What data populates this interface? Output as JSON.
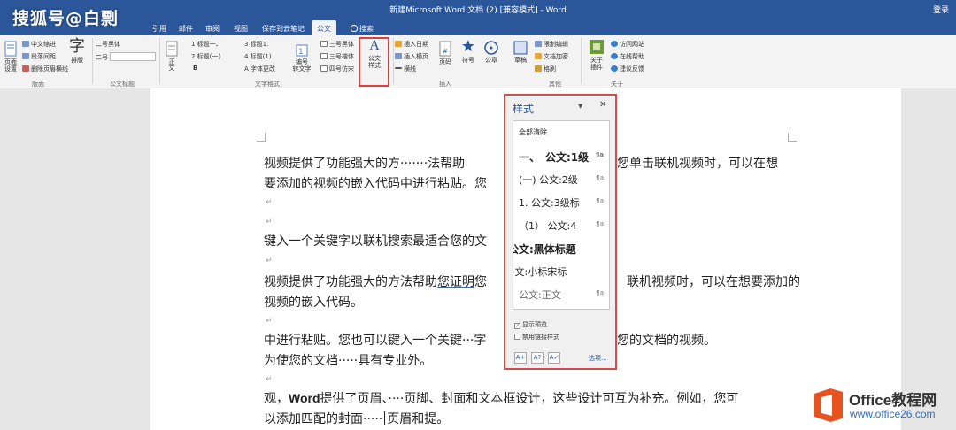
{
  "watermark": "搜狐号@白剽",
  "window": {
    "title": "新建Microsoft Word 文档 (2) [兼容模式] - Word",
    "signin": "登录"
  },
  "tabs": [
    {
      "label": "引用"
    },
    {
      "label": "邮件"
    },
    {
      "label": "审阅"
    },
    {
      "label": "视图"
    },
    {
      "label": "保存到云笔记"
    },
    {
      "label": "公文"
    },
    {
      "label": "搜索"
    }
  ],
  "ribbon": {
    "page_setup": "页面\n设置",
    "cn_indent": "中文缩进",
    "spacing": "段落间距",
    "delete_line": "删除页眉横线",
    "typeset": "排版",
    "group_layout": "版面",
    "font_name": "二号黑体",
    "font_size": "二号",
    "group_doc_title": "公文标题",
    "zhengwen": "正文",
    "h1": "1 标题一、",
    "h2": "2 标题(一)",
    "bold": "B",
    "h3": "3 标题1.",
    "h4": "4 标题(1)",
    "font_change": "A 字体更改",
    "number_to_text": "编号\n转文字",
    "three_bold": "三号黑体",
    "three_kai": "三号楷体",
    "four_fangsong": "四号仿宋",
    "group_text_format": "文字格式",
    "doc_style": "公文\n样式",
    "insert_date": "插入日期",
    "insert_header": "插入横页",
    "line": "横线",
    "group_insert": "插入",
    "page_num": "页码",
    "symbol": "符号",
    "seal": "公章",
    "draft": "草稿",
    "restrict_edit": "限制编辑",
    "doc_encrypt": "文档加密",
    "format_painter": "格刷",
    "group_other": "其他",
    "about_plugin": "关于\n插件",
    "visit_site": "访问网站",
    "online_help": "在线帮助",
    "feedback": "建议反馈",
    "group_about": "关于"
  },
  "document": {
    "lines": [
      "视频提供了功能强大的方·······法帮助",
      "您单击联机视频时，可以在想",
      "要添加的视频的嵌入代码中进行粘贴。您",
      "键入一个关键字以联机搜索最适合您的文",
      "视频提供了功能强大的方法帮助",
      "您证明",
      "您",
      "联机视频时，可以在想要添加的",
      "视频的嵌入代码。",
      "中进行粘贴。您也可以键入一个关键···字",
      "您的文档的视频。",
      "为使您的文档·····具有专业外。",
      "观，",
      "Word",
      "提供了页眉、····页脚、封面和文本框设计，这些设计可互为补充。例如，您可",
      "以添加匹配的封面·····",
      "页眉和提。"
    ]
  },
  "styles_pane": {
    "title": "样式",
    "clear_all": "全部清除",
    "items": [
      {
        "label": "一、　公文:1级"
      },
      {
        "label": "(一)  公文:2级"
      },
      {
        "label": "1. 公文:3级标"
      },
      {
        "label": "（1）  公文:4"
      },
      {
        "label": "公文:黑体标题"
      },
      {
        "label": "·文:小标宋标"
      },
      {
        "label": "公文:正文"
      }
    ],
    "pil": "¶a",
    "show_preview": "显示预览",
    "disable_linked": "禁用链接样式",
    "options": "选项..."
  },
  "logo": {
    "title": "Office教程网",
    "url": "www.office26.com"
  }
}
